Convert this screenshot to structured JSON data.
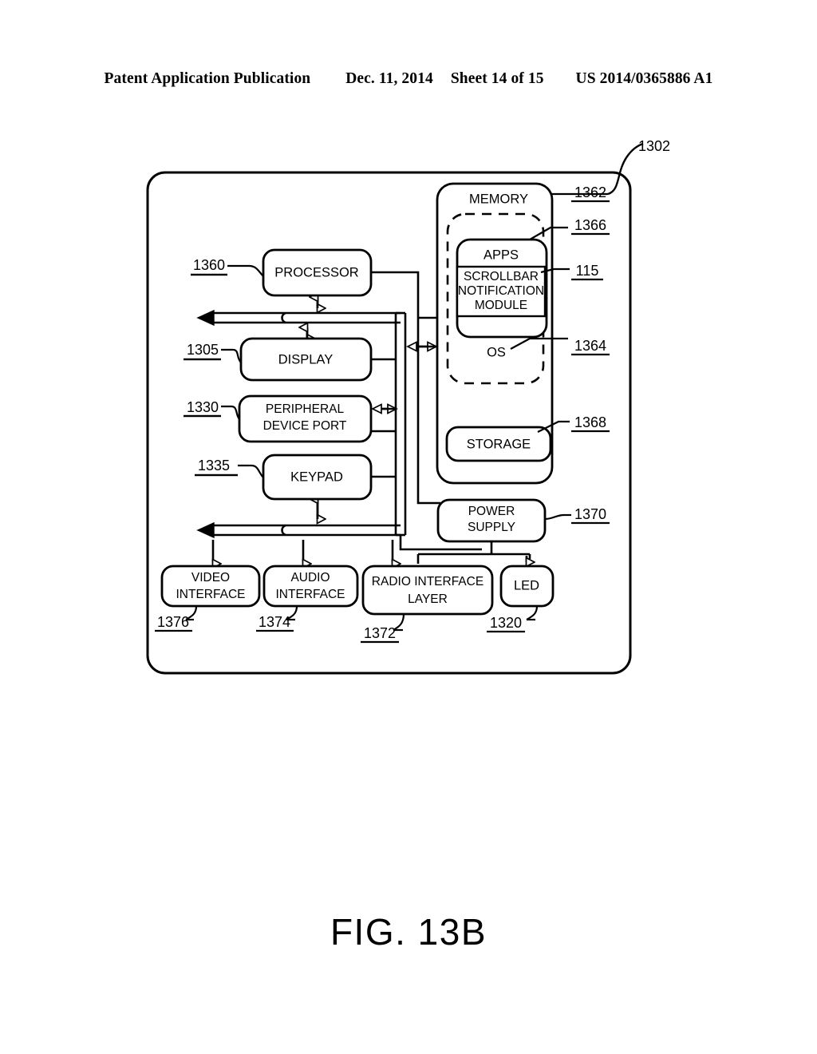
{
  "header": {
    "publication": "Patent Application Publication",
    "date": "Dec. 11, 2014",
    "sheet": "Sheet 14 of 15",
    "patent_number": "US 2014/0365886 A1"
  },
  "figure": {
    "caption": "FIG. 13B",
    "system_ref": "1302"
  },
  "blocks": {
    "processor": {
      "label": "PROCESSOR",
      "ref": "1360"
    },
    "display": {
      "label": "DISPLAY",
      "ref": "1305"
    },
    "peripheral_port": {
      "label_line1": "PERIPHERAL",
      "label_line2": "DEVICE PORT",
      "ref": "1330"
    },
    "keypad": {
      "label": "KEYPAD",
      "ref": "1335"
    },
    "memory": {
      "label": "MEMORY",
      "ref": "1362"
    },
    "os": {
      "label": "OS",
      "ref": "1364"
    },
    "apps": {
      "label": "APPS",
      "ref": "1366"
    },
    "scrollbar_module": {
      "label_line1": "SCROLLBAR",
      "label_line2": "NOTIFICATION",
      "label_line3": "MODULE",
      "ref": "115"
    },
    "storage": {
      "label": "STORAGE",
      "ref": "1368"
    },
    "power_supply": {
      "label_line1": "POWER",
      "label_line2": "SUPPLY",
      "ref": "1370"
    },
    "video_interface": {
      "label_line1": "VIDEO",
      "label_line2": "INTERFACE",
      "ref": "1376"
    },
    "audio_interface": {
      "label_line1": "AUDIO",
      "label_line2": "INTERFACE",
      "ref": "1374"
    },
    "radio_interface": {
      "label_line1": "RADIO INTERFACE",
      "label_line2": "LAYER",
      "ref": "1372"
    },
    "led": {
      "label": "LED",
      "ref": "1320"
    }
  },
  "colors": {
    "stroke": "#000000",
    "background": "#ffffff"
  }
}
